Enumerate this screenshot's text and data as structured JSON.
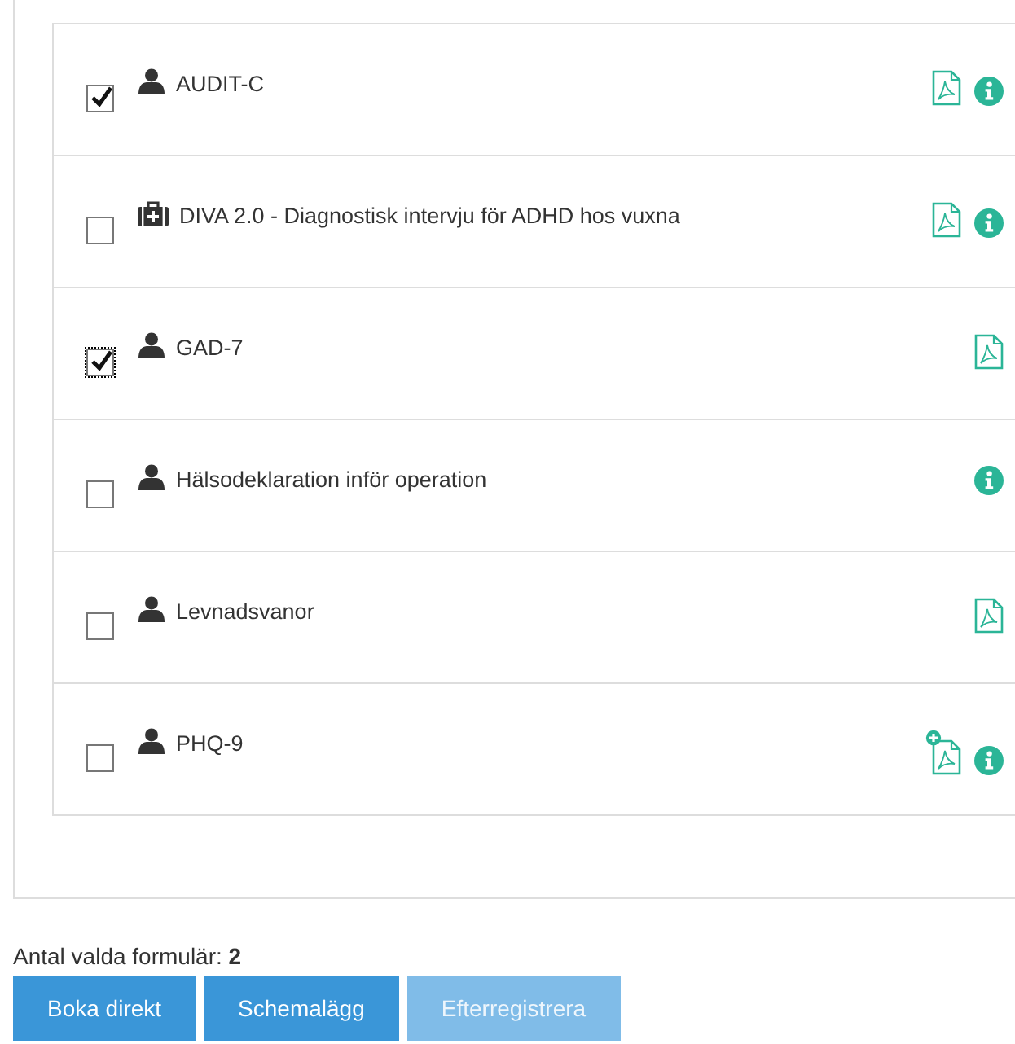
{
  "forms": [
    {
      "name": "AUDIT-C",
      "kind": "person",
      "checked": true,
      "focused": false,
      "pdf": true,
      "pdf_add": false,
      "info": true
    },
    {
      "name": "DIVA 2.0 - Diagnostisk intervju för ADHD hos vuxna",
      "kind": "medkit",
      "checked": false,
      "focused": false,
      "pdf": true,
      "pdf_add": false,
      "info": true
    },
    {
      "name": "GAD-7",
      "kind": "person",
      "checked": true,
      "focused": true,
      "pdf": true,
      "pdf_add": false,
      "info": false
    },
    {
      "name": "Hälsodeklaration inför operation",
      "kind": "person",
      "checked": false,
      "focused": false,
      "pdf": false,
      "info": true
    },
    {
      "name": "Levnadsvanor",
      "kind": "person",
      "checked": false,
      "focused": false,
      "pdf": true,
      "pdf_add": false,
      "info": false
    },
    {
      "name": "PHQ-9",
      "kind": "person",
      "checked": false,
      "focused": false,
      "pdf": true,
      "pdf_add": true,
      "info": true
    }
  ],
  "selected_count": "Antal valda formulär: **2**",
  "buttons": [
    {
      "label": "Boka direkt",
      "disabled": false
    },
    {
      "label": "Schemalägg",
      "disabled": false
    },
    {
      "label": "Efterregistrera",
      "disabled": true
    }
  ]
}
